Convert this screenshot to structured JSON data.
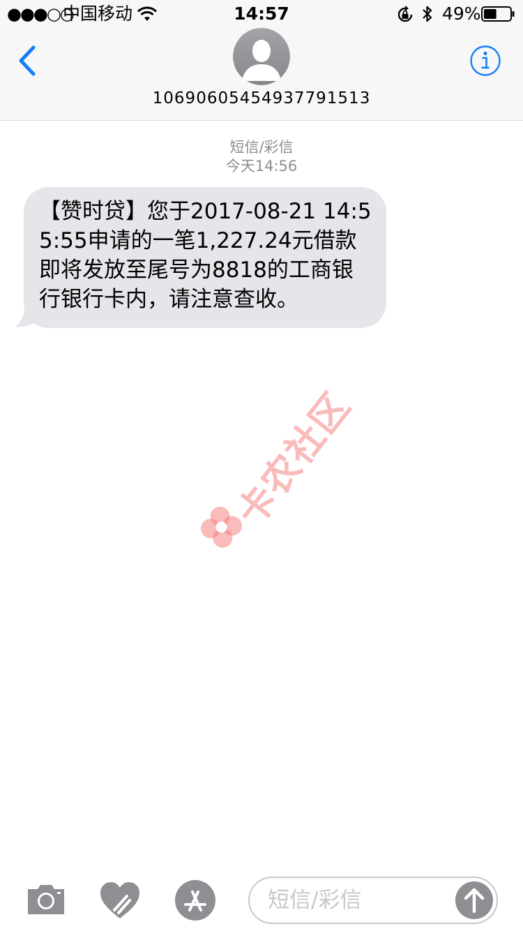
{
  "status_bar": {
    "signal": "●●●○○",
    "carrier": "中国移动",
    "time": "14:57",
    "battery_percent": "49%",
    "battery_level": 0.49
  },
  "header": {
    "contact_number": "10690605454937791513"
  },
  "conversation": {
    "message_type": "短信/彩信",
    "timestamp": "今天14:56",
    "messages": [
      {
        "direction": "incoming",
        "text": "【赞时贷】您于2017-08-21 14:55:55申请的一笔1,227.24元借款即将发放至尾号为8818的工商银行银行卡内，请注意查收。"
      }
    ]
  },
  "watermark": {
    "text": "卡农社区"
  },
  "toolbar": {
    "input_placeholder": "短信/彩信"
  },
  "colors": {
    "accent": "#147efb",
    "bubble_incoming": "#e5e5ea",
    "icon_gray": "#8e8e93",
    "watermark": "#f57878"
  }
}
